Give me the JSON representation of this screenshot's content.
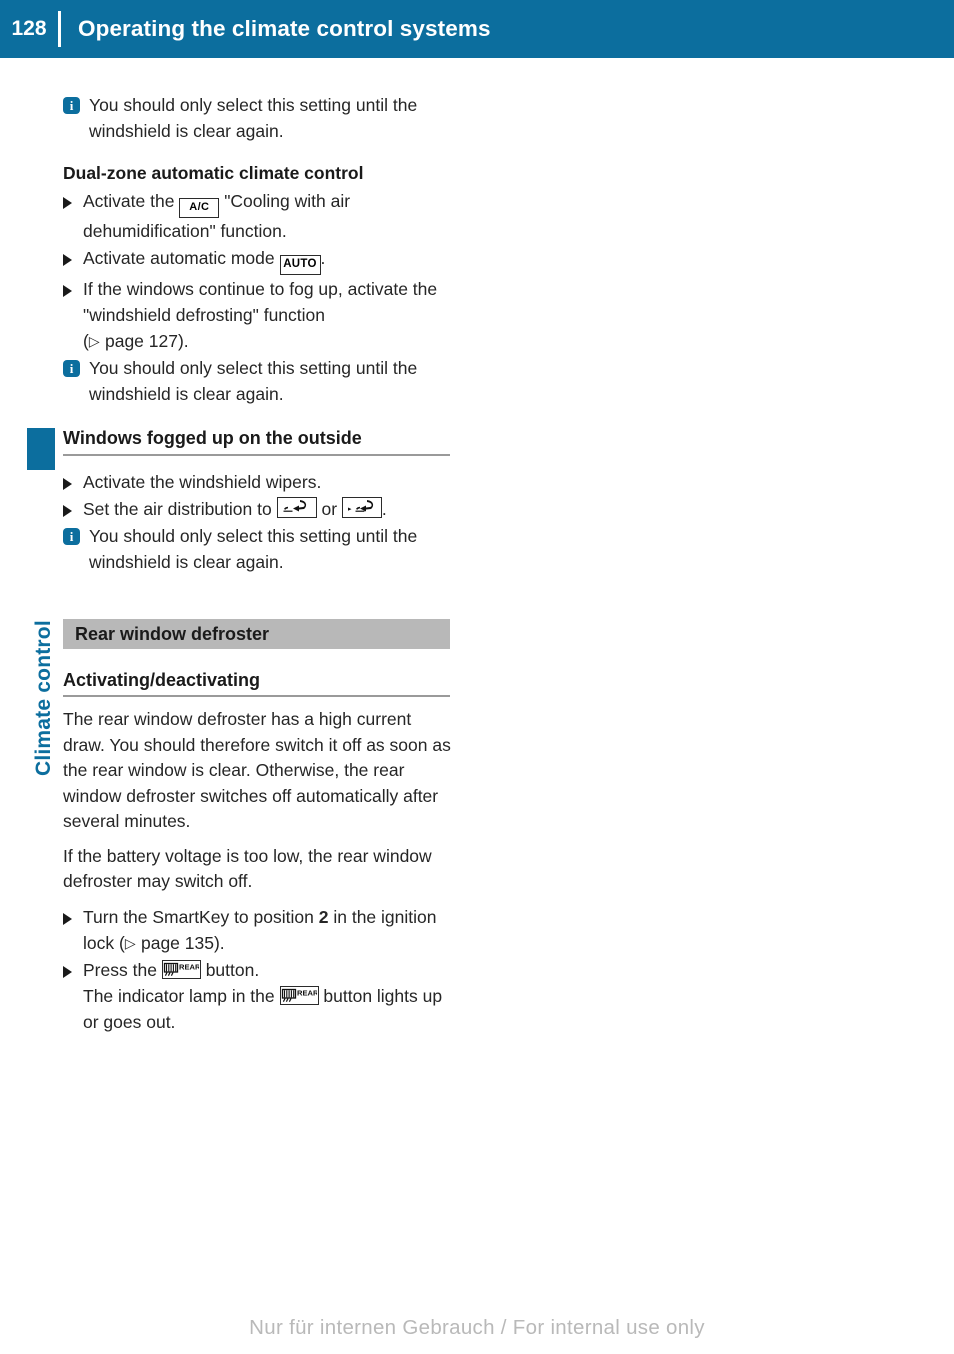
{
  "header": {
    "page_number": "128",
    "title": "Operating the climate control systems"
  },
  "side_tab": {
    "label": "Climate control"
  },
  "content": {
    "note_1": {
      "icon": "info-icon",
      "text": "You should only select this setting until the windshield is clear again."
    },
    "heading_dual_zone": "Dual-zone automatic climate control",
    "step_ac": {
      "text_before": "Activate the",
      "button_label": "A/C",
      "button_icon": "ac-button-icon",
      "text_after": "\"Cooling with air dehumidification\" function."
    },
    "step_auto": {
      "text_before": "Activate automatic mode",
      "button_label": "AUTO",
      "button_icon": "auto-button-icon",
      "text_after": "."
    },
    "step_defrost": {
      "text": "If the windows continue to fog up, activate the \"windshield defrosting\" function",
      "ref_open": "(",
      "ref_marker": "▷",
      "ref_text": "page 127",
      "ref_close": ")."
    },
    "note_2": {
      "icon": "info-icon",
      "text": "You should only select this setting until the windshield is clear again."
    },
    "heading_windows_fogged": "Windows fogged up on the outside",
    "step_wipers": {
      "text": "Activate the windshield wipers."
    },
    "step_air_distribution": {
      "text_before": "Set the air distribution to",
      "icon_1": "air-distribution-windshield-icon",
      "text_middle": "or",
      "icon_2": "air-distribution-windshield-footwell-icon",
      "text_after": "."
    },
    "note_3": {
      "icon": "info-icon",
      "text": "You should only select this setting until the windshield is clear again."
    },
    "heading_rear_defroster": "Rear window defroster",
    "heading_activating": "Activating/deactivating",
    "para_1": "The rear window defroster has a high current draw. You should therefore switch it off as soon as the rear window is clear. Otherwise, the rear window defroster switches off automatically after several minutes.",
    "para_2": "If the battery voltage is too low, the rear window defroster may switch off.",
    "step_smartkey": {
      "text_before": "Turn the SmartKey to position",
      "position_value": "2",
      "text_mid": "in the ignition lock",
      "ref_open": "(",
      "ref_marker": "▷",
      "ref_text": "page 135",
      "ref_close": ")."
    },
    "step_press_button": {
      "text_before": "Press the",
      "button_icon": "rear-defroster-button-icon",
      "button_label": "REAR",
      "text_after": "button.",
      "line_2_before": "The indicator lamp in the",
      "line_2_after": "button lights up or goes out."
    }
  },
  "footer": {
    "watermark": "Nur für internen Gebrauch / For internal use only"
  },
  "colors": {
    "header_blue": "#0c6e9e",
    "band_gray": "#b8b8b8",
    "rule_gray": "#9a9a9a",
    "text": "#262626",
    "watermark_gray": "#b9b9b9"
  }
}
